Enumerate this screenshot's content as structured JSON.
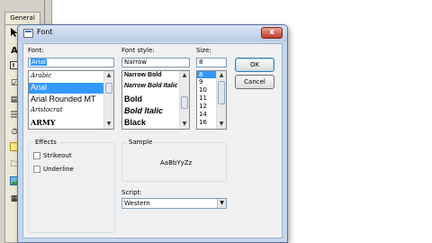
{
  "background": {
    "tab_label": "General",
    "tools": [
      "A",
      "☑",
      "▤",
      "⏱",
      "🗀",
      "▦"
    ]
  },
  "dialog": {
    "title": "Font",
    "close_glyph": "x",
    "font": {
      "label": "Font:",
      "value": "Arial",
      "items": [
        {
          "text": "Arabic",
          "style": "script"
        },
        {
          "text": "Arial",
          "style": "selected"
        },
        {
          "text": "Arial Rounded MT",
          "style": "normal"
        },
        {
          "text": "Aristocrat",
          "style": "script"
        },
        {
          "text": "ARMY",
          "style": "army"
        }
      ]
    },
    "font_style": {
      "label": "Font style:",
      "value": "Narrow",
      "items": [
        {
          "text": "Narrow Bold",
          "style": "bold"
        },
        {
          "text": "Narrow Bold Italic",
          "style": "bolditalic"
        },
        {
          "text": "Bold",
          "style": "bold"
        },
        {
          "text": "Bold Italic",
          "style": "bolditalic"
        },
        {
          "text": "Black",
          "style": "black"
        }
      ]
    },
    "size": {
      "label": "Size:",
      "value": "8",
      "items": [
        "8",
        "9",
        "10",
        "11",
        "12",
        "14",
        "16"
      ]
    },
    "ok_label": "OK",
    "cancel_label": "Cancel",
    "effects": {
      "title": "Effects",
      "strikeout_label": "Strikeout",
      "underline_label": "Underline"
    },
    "sample": {
      "title": "Sample",
      "text": "AaBbYyZz"
    },
    "script": {
      "label": "Script:",
      "value": "Western"
    },
    "colors": {
      "selection": "#3399ff",
      "dialog_frame": "#c6d6ec"
    }
  }
}
